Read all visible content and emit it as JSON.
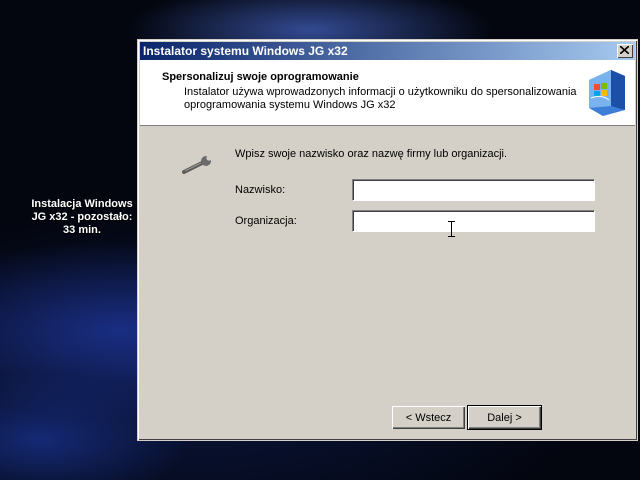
{
  "desktop": {
    "status_line1": "Instalacja Windows",
    "status_line2": "JG x32 - pozostało:",
    "status_line3": "33 min."
  },
  "window": {
    "title": "Instalator systemu Windows JG x32",
    "header": {
      "title": "Spersonalizuj swoje oprogramowanie",
      "description": "Instalator używa wprowadzonych informacji o użytkowniku do spersonalizowania oprogramowania systemu Windows JG x32"
    },
    "instruction": "Wpisz swoje nazwisko oraz nazwę firmy lub organizacji.",
    "fields": {
      "name_label": "Nazwisko:",
      "name_value": "",
      "org_label": "Organizacja:",
      "org_value": ""
    },
    "buttons": {
      "back": "< Wstecz",
      "next": "Dalej >"
    }
  },
  "colors": {
    "title_gradient_start": "#0a246a",
    "title_gradient_end": "#a6caf0",
    "dialog_face": "#d4d0c8"
  },
  "icons": [
    "close-icon",
    "windows-logo-icon",
    "wrench-icon",
    "ibeam-cursor-icon"
  ]
}
